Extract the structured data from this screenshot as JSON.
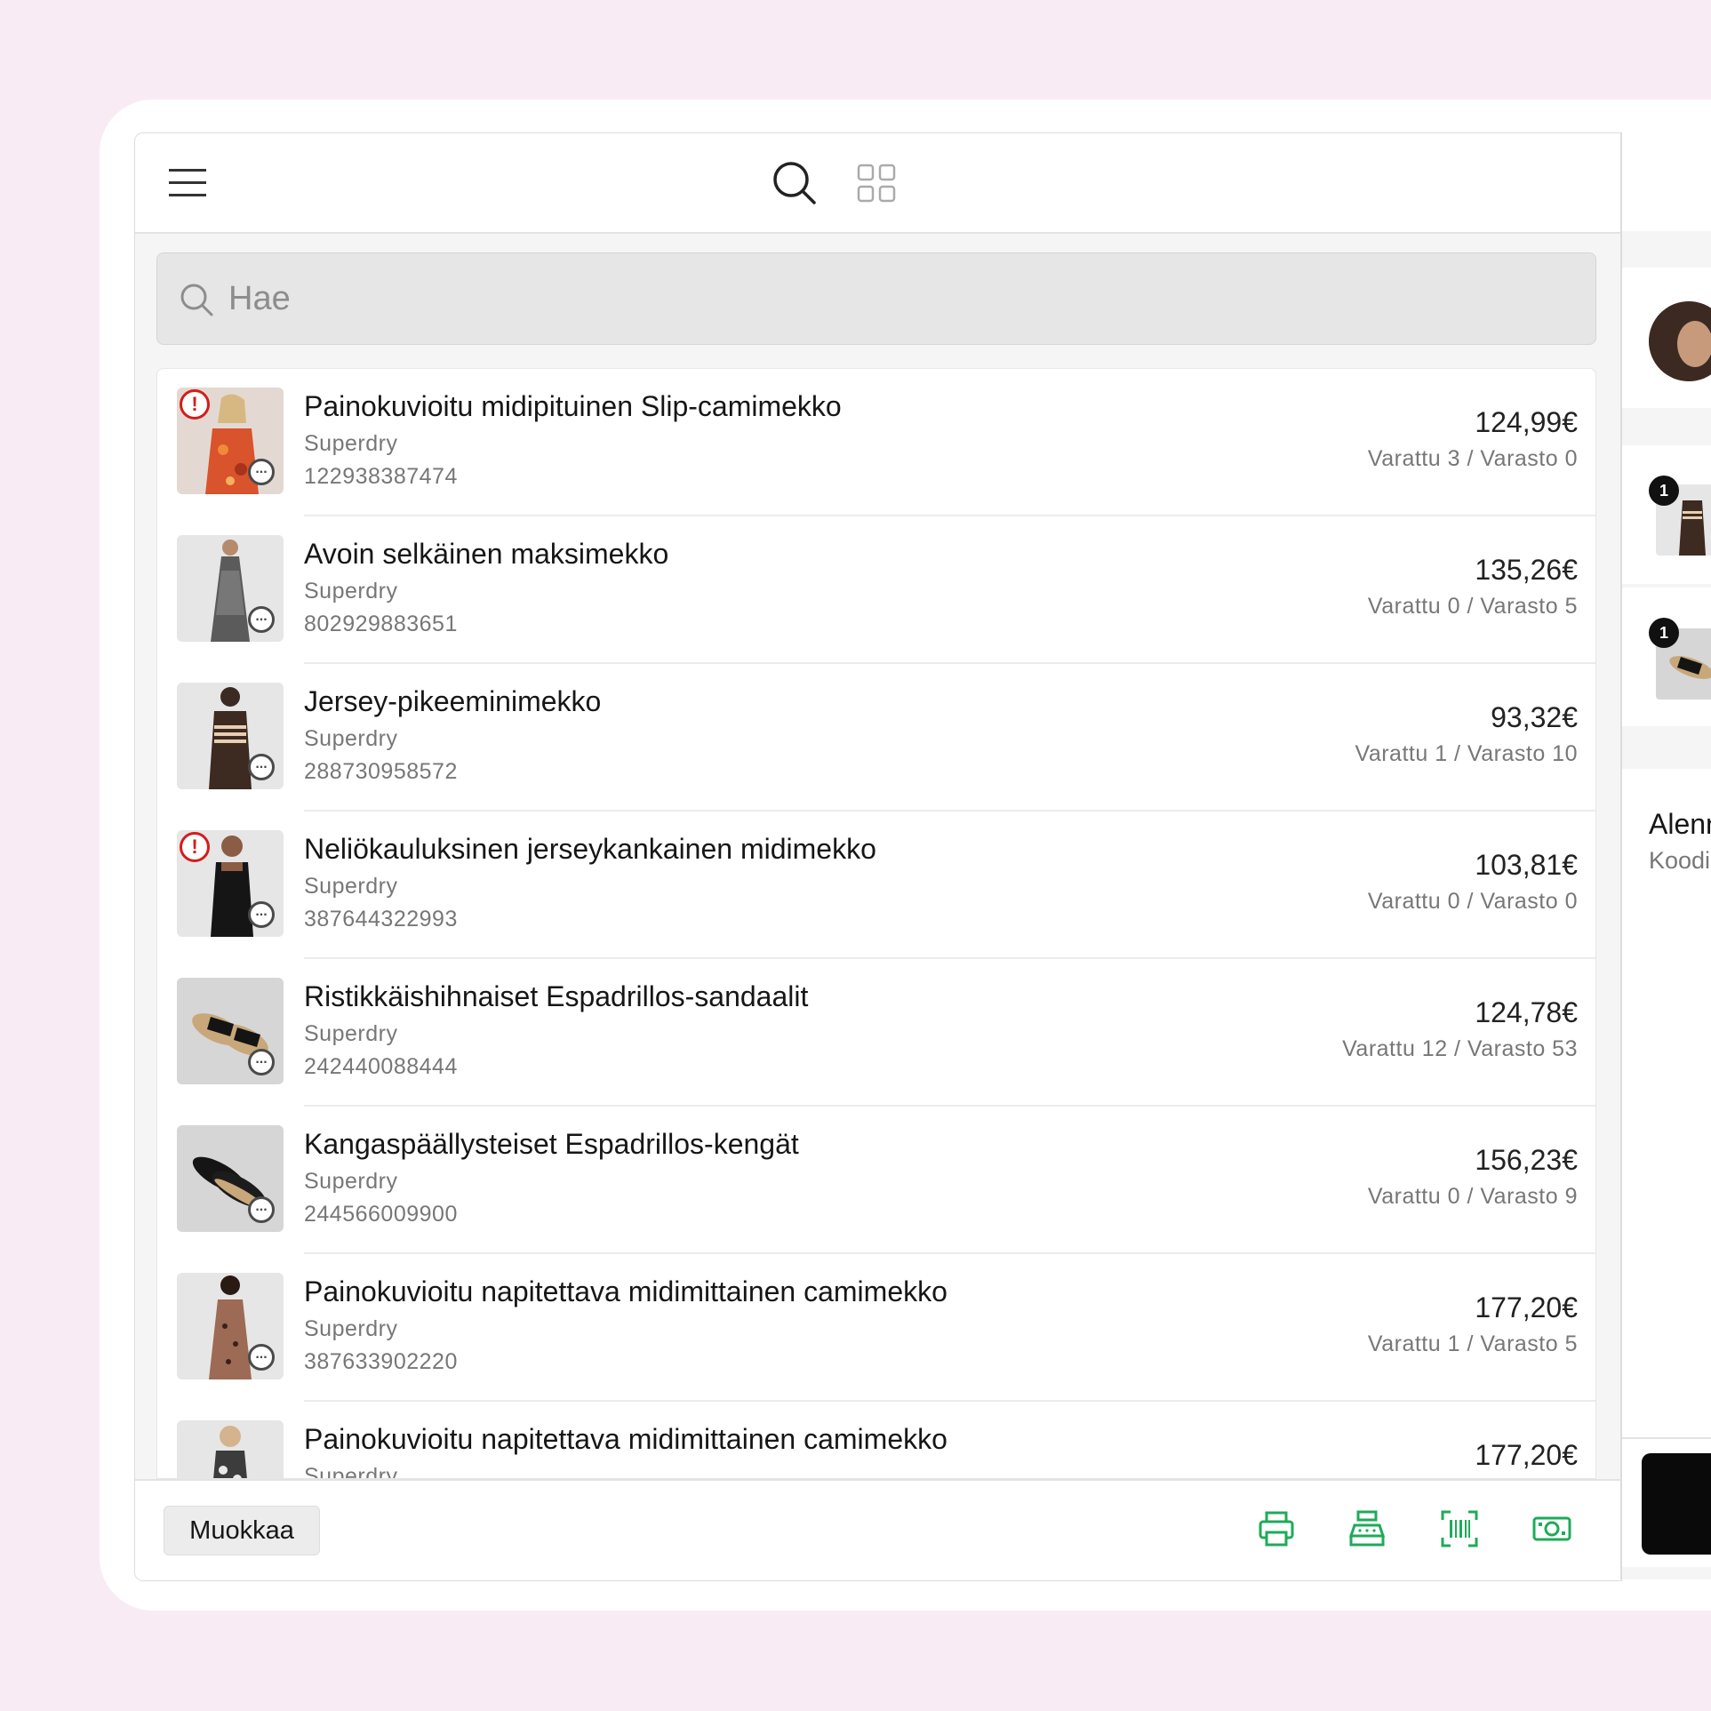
{
  "header": {
    "menu_icon": "hamburger-menu-icon",
    "search_icon": "search-icon",
    "grid_icon": "grid-view-icon"
  },
  "search": {
    "placeholder": "Hae",
    "icon": "search-icon"
  },
  "products": [
    {
      "name": "Painokuvioitu midipituinen Slip-camimekko",
      "brand": "Superdry",
      "sku": "122938387474",
      "price": "124,99€",
      "stock": "Varattu 3 / Varasto 0",
      "warning": true
    },
    {
      "name": "Avoin selkäinen maksimekko",
      "brand": "Superdry",
      "sku": "802929883651",
      "price": "135,26€",
      "stock": "Varattu 0 / Varasto 5",
      "warning": false
    },
    {
      "name": "Jersey-pikeeminimekko",
      "brand": "Superdry",
      "sku": "288730958572",
      "price": "93,32€",
      "stock": "Varattu 1 / Varasto 10",
      "warning": false
    },
    {
      "name": "Neliökauluksinen jerseykankainen midimekko",
      "brand": "Superdry",
      "sku": "387644322993",
      "price": "103,81€",
      "stock": "Varattu 0 / Varasto 0",
      "warning": true
    },
    {
      "name": "Ristikkäishihnaiset Espadrillos-sandaalit",
      "brand": "Superdry",
      "sku": "242440088444",
      "price": "124,78€",
      "stock": "Varattu 12 / Varasto 53",
      "warning": false
    },
    {
      "name": "Kangaspäällysteiset Espadrillos-kengät",
      "brand": "Superdry",
      "sku": "244566009900",
      "price": "156,23€",
      "stock": "Varattu 0 / Varasto 9",
      "warning": false
    },
    {
      "name": "Painokuvioitu napitettava midimittainen camimekko",
      "brand": "Superdry",
      "sku": "387633902220",
      "price": "177,20€",
      "stock": "Varattu 1 / Varasto 5",
      "warning": false
    },
    {
      "name": "Painokuvioitu napitettava midimittainen camimekko",
      "brand": "Superdry",
      "sku": "",
      "price": "177,20€",
      "stock": "",
      "warning": false
    }
  ],
  "badges": {
    "warning": "!",
    "more": "..."
  },
  "footer": {
    "edit_label": "Muokkaa",
    "tools": [
      "printer-icon",
      "cash-register-icon",
      "barcode-scan-icon",
      "cash-icon"
    ],
    "accent_color": "#1faa59"
  },
  "cart": {
    "item_counts": [
      "1",
      "1"
    ],
    "discount_label": "Alenn",
    "code_label": "Koodi"
  }
}
